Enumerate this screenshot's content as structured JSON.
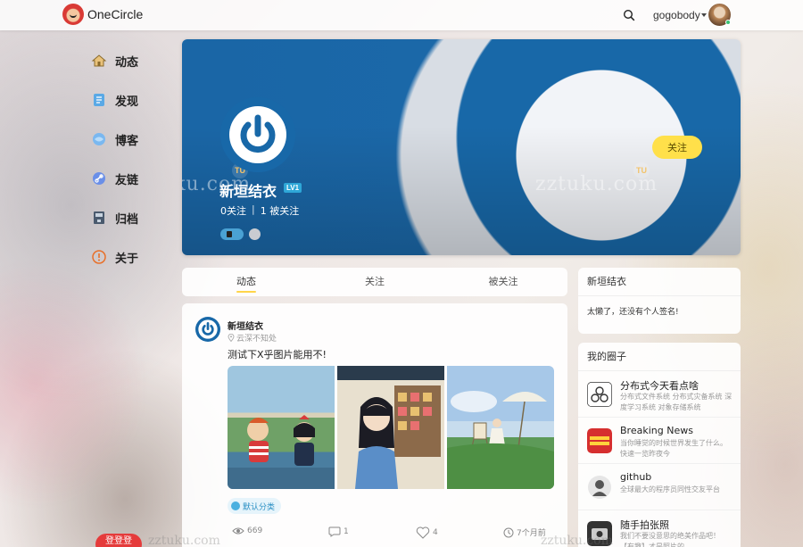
{
  "app": {
    "name": "OneCircle"
  },
  "user": {
    "name": "gogobody"
  },
  "nav": [
    {
      "label": "动态",
      "icon": "home-icon"
    },
    {
      "label": "发现",
      "icon": "discover-icon"
    },
    {
      "label": "博客",
      "icon": "blog-icon"
    },
    {
      "label": "友链",
      "icon": "link-icon"
    },
    {
      "label": "归档",
      "icon": "archive-icon"
    },
    {
      "label": "关于",
      "icon": "about-icon"
    }
  ],
  "profile": {
    "name": "新垣结衣",
    "level": "LV1",
    "following": "0关注",
    "followers": "1 被关注",
    "follow_button": "关注"
  },
  "tabs": [
    {
      "label": "动态",
      "active": true
    },
    {
      "label": "关注",
      "active": false
    },
    {
      "label": "被关注",
      "active": false
    }
  ],
  "post": {
    "author": "新垣结衣",
    "location": "云深不知处",
    "text": "测试下X乎图片能用不!",
    "category": "默认分类",
    "views": "669",
    "comments": "1",
    "likes": "4",
    "time": "7个月前"
  },
  "sidebar": {
    "bio_title": "新垣结衣",
    "bio_text": "太懒了，还没有个人签名!",
    "circles_title": "我的圈子",
    "circles": [
      {
        "name": "分布式今天看点啥",
        "desc": "分布式文件系统 分布式灾备系统 深度学习系统 对象存储系统"
      },
      {
        "name": "Breaking News",
        "desc": "当你睡觉的时候世界发生了什么。快速一览昨夜今"
      },
      {
        "name": "github",
        "desc": "全球最大的程序员同性交友平台"
      },
      {
        "name": "随手拍张照",
        "desc": "我们不要没意思的绝美作品吧！【有趣】才是照片的"
      }
    ]
  },
  "watermark": "zztuku.com",
  "bottom_button": "登登登",
  "colors": {
    "accent": "#ffe04a",
    "brand_blue": "#1868a8",
    "tag_blue": "#2a8fc4"
  }
}
